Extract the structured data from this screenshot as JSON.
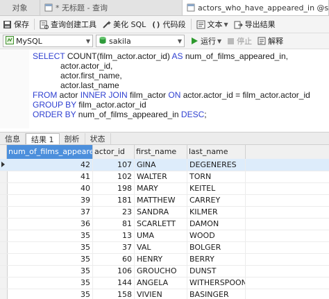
{
  "tabs": [
    {
      "label": "对象"
    },
    {
      "label": "* 无标题 - 查询"
    },
    {
      "label": "actors_who_have_appeared_in @sakila (M"
    }
  ],
  "toolbar": {
    "save": "保存",
    "query_builder": "查询创建工具",
    "beautify": "美化 SQL",
    "snippet": "代码段",
    "text": "文本",
    "export": "导出结果"
  },
  "toolbar2": {
    "connection": "MySQL",
    "database": "sakila",
    "run": "运行",
    "stop": "停止",
    "explain": "解释"
  },
  "sql_lines": [
    [
      {
        "t": "SELECT ",
        "k": true
      },
      {
        "t": "COUNT(film_actor.actor_id) "
      },
      {
        "t": "AS",
        "k": true
      },
      {
        "t": " num_of_films_appeared_in,"
      }
    ],
    [
      {
        "t": "            actor.actor_id,"
      }
    ],
    [
      {
        "t": "            actor.first_name,"
      }
    ],
    [
      {
        "t": "            actor.last_name"
      }
    ],
    [
      {
        "t": "FROM",
        "k": true
      },
      {
        "t": " actor "
      },
      {
        "t": "INNER JOIN",
        "k": true
      },
      {
        "t": " film_actor "
      },
      {
        "t": "ON",
        "k": true
      },
      {
        "t": " actor.actor_id = film_actor.actor_id"
      }
    ],
    [
      {
        "t": "GROUP BY",
        "k": true
      },
      {
        "t": " film_actor.actor_id"
      }
    ],
    [
      {
        "t": "ORDER BY",
        "k": true
      },
      {
        "t": " num_of_films_appeared_in "
      },
      {
        "t": "DESC",
        "k": true
      },
      {
        "t": ";"
      }
    ]
  ],
  "result_tabs": [
    "信息",
    "结果 1",
    "剖析",
    "状态"
  ],
  "active_result_tab": 1,
  "columns": [
    "num_of_films_appeared_ir",
    "actor_id",
    "first_name",
    "last_name"
  ],
  "rows": [
    [
      "42",
      "107",
      "GINA",
      "DEGENERES"
    ],
    [
      "41",
      "102",
      "WALTER",
      "TORN"
    ],
    [
      "40",
      "198",
      "MARY",
      "KEITEL"
    ],
    [
      "39",
      "181",
      "MATTHEW",
      "CARREY"
    ],
    [
      "37",
      "23",
      "SANDRA",
      "KILMER"
    ],
    [
      "36",
      "81",
      "SCARLETT",
      "DAMON"
    ],
    [
      "35",
      "13",
      "UMA",
      "WOOD"
    ],
    [
      "35",
      "37",
      "VAL",
      "BOLGER"
    ],
    [
      "35",
      "60",
      "HENRY",
      "BERRY"
    ],
    [
      "35",
      "106",
      "GROUCHO",
      "DUNST"
    ],
    [
      "35",
      "144",
      "ANGELA",
      "WITHERSPOON"
    ],
    [
      "35",
      "158",
      "VIVIEN",
      "BASINGER"
    ]
  ],
  "colors": {
    "keyword": "#2e3fd1",
    "selected_header": "#4c8fdc",
    "selected_row": "#ddecfb"
  }
}
